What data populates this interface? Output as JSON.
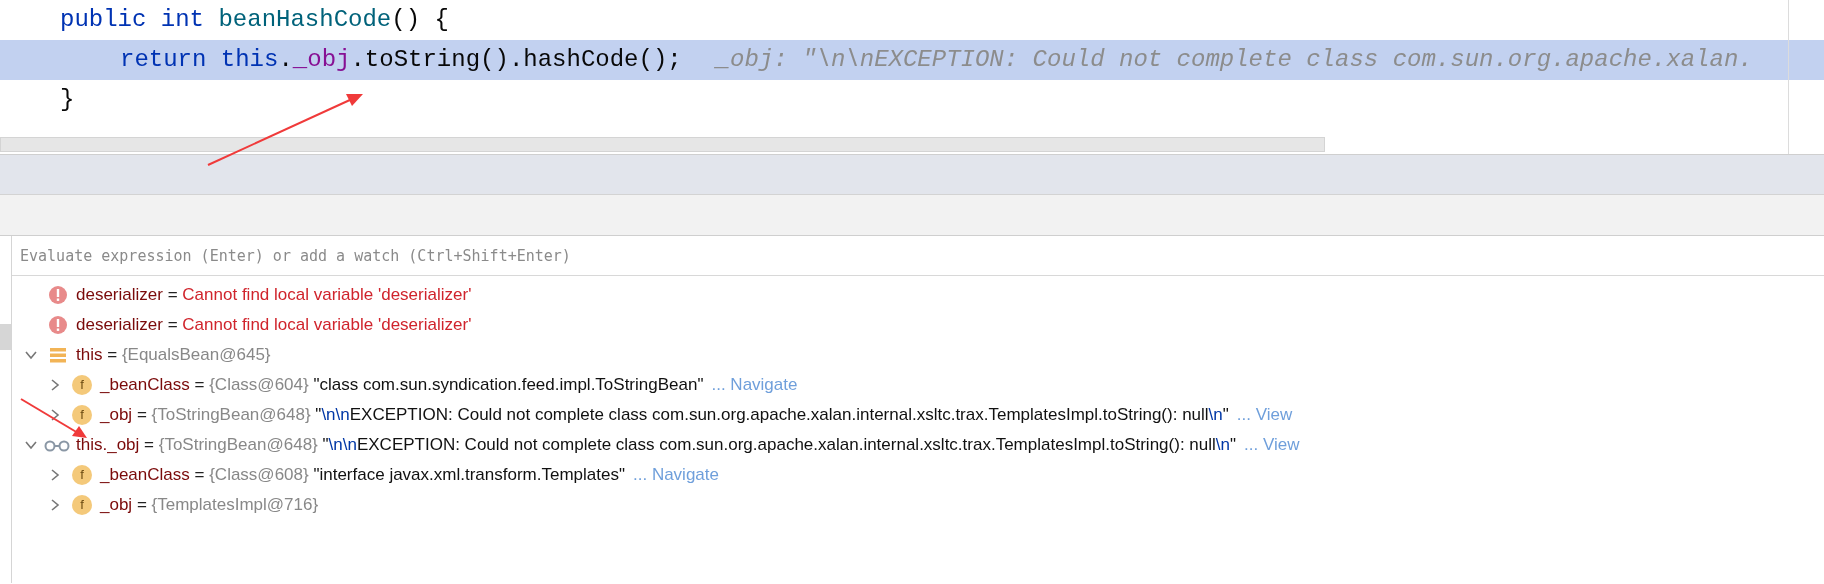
{
  "editor": {
    "lines": [
      {
        "current": false,
        "tokens": [
          {
            "kind": "keyword",
            "text": "public int "
          },
          {
            "kind": "method",
            "text": "beanHashCode"
          },
          {
            "kind": "plain",
            "text": "() {"
          }
        ],
        "children": [
          {
            "current": true,
            "tokens": [
              {
                "kind": "keyword",
                "text": "return this"
              },
              {
                "kind": "plain",
                "text": "."
              },
              {
                "kind": "field",
                "text": "_obj"
              },
              {
                "kind": "plain",
                "text": ".toString().hashCode();"
              }
            ],
            "hint": "_obj: \"\\n\\nEXCEPTION: Could not complete class com.sun.org.apache.xalan."
          }
        ]
      },
      {
        "current": false,
        "tokens": [
          {
            "kind": "plain",
            "text": "}"
          }
        ]
      }
    ]
  },
  "evaluate": {
    "placeholder": "Evaluate expression (Enter) or add a watch (Ctrl+Shift+Enter)"
  },
  "variables": [
    {
      "kind": "error",
      "name": "deserializer",
      "sign": "=",
      "message": "Cannot find local variable 'deserializer'"
    },
    {
      "kind": "error",
      "name": "deserializer",
      "sign": "=",
      "message": "Cannot find local variable 'deserializer'"
    },
    {
      "kind": "object",
      "name": "this",
      "sign": "=",
      "expanded": true,
      "type": "{EqualsBean@645}",
      "children": [
        {
          "kind": "field",
          "badge": "f",
          "name": "_beanClass",
          "sign": "=",
          "expanded": false,
          "type": "{Class@604}",
          "value": [
            {
              "text": "\"class com.sun.syndication.feed.impl.ToStringBean\""
            }
          ],
          "link": "... Navigate"
        },
        {
          "kind": "field",
          "badge": "f",
          "name": "_obj",
          "sign": "=",
          "expanded": false,
          "type": "{ToStringBean@648}",
          "value": [
            {
              "text": "\""
            },
            {
              "text": "\\n\\n",
              "escape": true
            },
            {
              "text": "EXCEPTION: Could not complete class com.sun.org.apache.xalan.internal.xsltc.trax.TemplatesImpl.toString(): null"
            },
            {
              "text": "\\n",
              "escape": true
            },
            {
              "text": "\""
            }
          ],
          "link": "... View"
        }
      ]
    },
    {
      "kind": "watch",
      "name": "this._obj",
      "sign": "=",
      "expanded": true,
      "type": "{ToStringBean@648}",
      "value": [
        {
          "text": "\""
        },
        {
          "text": "\\n\\n",
          "escape": true
        },
        {
          "text": "EXCEPTION: Could not complete class com.sun.org.apache.xalan.internal.xsltc.trax.TemplatesImpl.toString(): null"
        },
        {
          "text": "\\n",
          "escape": true
        },
        {
          "text": "\""
        }
      ],
      "link": "... View",
      "children": [
        {
          "kind": "field",
          "badge": "f",
          "name": "_beanClass",
          "sign": "=",
          "expanded": false,
          "type": "{Class@608}",
          "value": [
            {
              "text": "\"interface javax.xml.transform.Templates\""
            }
          ],
          "link": "... Navigate"
        },
        {
          "kind": "field",
          "badge": "f",
          "name": "_obj",
          "sign": "=",
          "expanded": false,
          "type": "{TemplatesImpl@716}"
        }
      ]
    }
  ]
}
